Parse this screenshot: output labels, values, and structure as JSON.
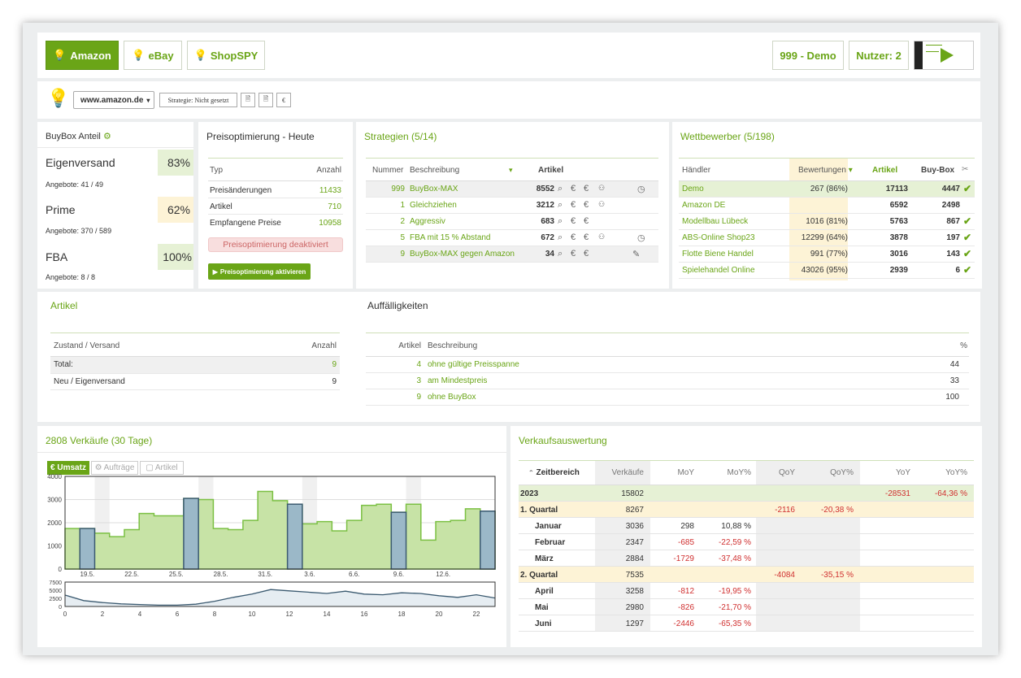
{
  "topbar": {
    "tabs": [
      {
        "label": "Amazon",
        "icon": "lightbulb-icon",
        "active": true
      },
      {
        "label": "eBay",
        "icon": "lightbulb-icon",
        "active": false
      },
      {
        "label": "ShopSPY",
        "icon": "lightbulb-icon",
        "active": false
      }
    ],
    "demo_label": "999 - Demo",
    "users_label": "Nutzer: 2",
    "play_icon": "play-icon"
  },
  "toolbar": {
    "domain_select": "www.amazon.de",
    "strategy_label": "Strategie: Nicht gesetzt",
    "euro_label": "€"
  },
  "buybox": {
    "title": "BuyBox Anteil",
    "items": [
      {
        "label": "Eigenversand",
        "percent": "83%",
        "sub": "Angebote: 41 / 49",
        "bg": "#e6f1d5"
      },
      {
        "label": "Prime",
        "percent": "62%",
        "sub": "Angebote: 370 / 589",
        "bg": "#fdf3d6"
      },
      {
        "label": "FBA",
        "percent": "100%",
        "sub": "Angebote: 8 / 8",
        "bg": "#e6f1d5"
      }
    ]
  },
  "preisopt": {
    "title": "Preisoptimierung - Heute",
    "col_type": "Typ",
    "col_count": "Anzahl",
    "rows": [
      {
        "label": "Preisänderungen",
        "value": "11433"
      },
      {
        "label": "Artikel",
        "value": "710"
      },
      {
        "label": "Empfangene Preise",
        "value": "10958"
      }
    ],
    "status": "Preisoptimierung deaktiviert",
    "activate_button": "Preisoptimierung aktivieren"
  },
  "strategien": {
    "title": "Strategien (5/14)",
    "col_num": "Nummer",
    "col_desc": "Beschreibung",
    "col_art": "Artikel",
    "rows": [
      {
        "num": "999",
        "desc": "BuyBox-MAX",
        "count": "8552"
      },
      {
        "num": "1",
        "desc": "Gleichziehen",
        "count": "3212"
      },
      {
        "num": "2",
        "desc": "Aggressiv",
        "count": "683"
      },
      {
        "num": "5",
        "desc": "FBA mit 15 % Abstand",
        "count": "672"
      },
      {
        "num": "9",
        "desc": "BuyBox-MAX gegen Amazon",
        "count": "34"
      }
    ]
  },
  "wettbewerber": {
    "title": "Wettbewerber (5/198)",
    "col_h": "Händler",
    "col_b": "Bewertungen",
    "col_a": "Artikel",
    "col_bb": "Buy-Box",
    "rows": [
      {
        "name": "Demo",
        "rating": "267 (86%)",
        "art": "17113",
        "bb": "4447",
        "check": true
      },
      {
        "name": "Amazon DE",
        "rating": "",
        "art": "6592",
        "bb": "2498",
        "check": false
      },
      {
        "name": "Modellbau Lübeck",
        "rating": "1016 (81%)",
        "art": "5763",
        "bb": "867",
        "check": true
      },
      {
        "name": "ABS-Online Shop23",
        "rating": "12299 (64%)",
        "art": "3878",
        "bb": "197",
        "check": true
      },
      {
        "name": "Flotte Biene Handel",
        "rating": "991 (77%)",
        "art": "3016",
        "bb": "143",
        "check": true
      },
      {
        "name": "Spielehandel Online",
        "rating": "43026 (95%)",
        "art": "2939",
        "bb": "6",
        "check": true
      }
    ]
  },
  "artikel": {
    "title": "Artikel",
    "col_z": "Zustand / Versand",
    "col_n": "Anzahl",
    "rows": [
      {
        "label": "Total:",
        "value": "9"
      },
      {
        "label": "Neu / Eigenversand",
        "value": "9"
      }
    ]
  },
  "auffaellig": {
    "title": "Auffälligkeiten",
    "col_a": "Artikel",
    "col_b": "Beschreibung",
    "col_p": "%",
    "rows": [
      {
        "count": "4",
        "desc": "ohne gültige Preisspanne",
        "pct": "44"
      },
      {
        "count": "3",
        "desc": "am Mindestpreis",
        "pct": "33"
      },
      {
        "count": "9",
        "desc": "ohne BuyBox",
        "pct": "100"
      }
    ]
  },
  "sales": {
    "title": "2808 Verkäufe (30 Tage)",
    "tabs": [
      "€ Umsatz",
      "Aufträge",
      "Artikel"
    ]
  },
  "chart_data": [
    {
      "type": "bar",
      "ylim": [
        0,
        4000
      ],
      "yticks": [
        "4000",
        "3000",
        "2000",
        "1000",
        "0"
      ],
      "xticks": [
        "19.5.",
        "22.5.",
        "25.5.",
        "28.5.",
        "31.5.",
        "3.6.",
        "6.6.",
        "9.6.",
        "12.6."
      ],
      "values": [
        1750,
        1750,
        1550,
        1400,
        1700,
        2400,
        2300,
        2300,
        3050,
        3000,
        1750,
        1700,
        2100,
        3350,
        2950,
        2800,
        1950,
        2050,
        1650,
        2100,
        2750,
        2800,
        2450,
        2800,
        1250,
        2050,
        2100,
        2600,
        2500
      ],
      "highlight": [
        1,
        8,
        15,
        22,
        28
      ]
    },
    {
      "type": "line",
      "ylim": [
        0,
        7500
      ],
      "yticks": [
        "7500",
        "5000",
        "2500",
        "0"
      ],
      "xticks": [
        "0",
        "2",
        "4",
        "6",
        "8",
        "10",
        "12",
        "14",
        "16",
        "18",
        "20",
        "22"
      ],
      "values": [
        3500,
        1800,
        1200,
        800,
        600,
        400,
        400,
        700,
        1600,
        2800,
        3800,
        5200,
        4800,
        4400,
        4000,
        4700,
        3800,
        3600,
        4200,
        4000,
        3300,
        2800,
        3600,
        2600
      ]
    }
  ],
  "verkauf": {
    "title": "Verkaufsauswertung",
    "headers": [
      "Zeitbereich",
      "Verkäufe",
      "MoY",
      "MoY%",
      "QoY",
      "QoY%",
      "YoY",
      "YoY%"
    ],
    "rows": [
      {
        "label": "2023",
        "v": "15802",
        "moy": "",
        "moyp": "",
        "qoy": "",
        "qoyp": "",
        "yoy": "-28531",
        "yoyp": "-64,36 %",
        "level": 0
      },
      {
        "label": "1. Quartal",
        "v": "8267",
        "moy": "",
        "moyp": "",
        "qoy": "-2116",
        "qoyp": "-20,38 %",
        "yoy": "",
        "yoyp": "",
        "level": 1
      },
      {
        "label": "Januar",
        "v": "3036",
        "moy": "298",
        "moyp": "10,88 %",
        "qoy": "",
        "qoyp": "",
        "yoy": "",
        "yoyp": "",
        "level": 2
      },
      {
        "label": "Februar",
        "v": "2347",
        "moy": "-685",
        "moyp": "-22,59 %",
        "qoy": "",
        "qoyp": "",
        "yoy": "",
        "yoyp": "",
        "level": 2
      },
      {
        "label": "März",
        "v": "2884",
        "moy": "-1729",
        "moyp": "-37,48 %",
        "qoy": "",
        "qoyp": "",
        "yoy": "",
        "yoyp": "",
        "level": 2
      },
      {
        "label": "2. Quartal",
        "v": "7535",
        "moy": "",
        "moyp": "",
        "qoy": "-4084",
        "qoyp": "-35,15 %",
        "yoy": "",
        "yoyp": "",
        "level": 1
      },
      {
        "label": "April",
        "v": "3258",
        "moy": "-812",
        "moyp": "-19,95 %",
        "qoy": "",
        "qoyp": "",
        "yoy": "",
        "yoyp": "",
        "level": 2
      },
      {
        "label": "Mai",
        "v": "2980",
        "moy": "-826",
        "moyp": "-21,70 %",
        "qoy": "",
        "qoyp": "",
        "yoy": "",
        "yoyp": "",
        "level": 2
      },
      {
        "label": "Juni",
        "v": "1297",
        "moy": "-2446",
        "moyp": "-65,35 %",
        "qoy": "",
        "qoyp": "",
        "yoy": "",
        "yoyp": "",
        "level": 2
      }
    ]
  }
}
